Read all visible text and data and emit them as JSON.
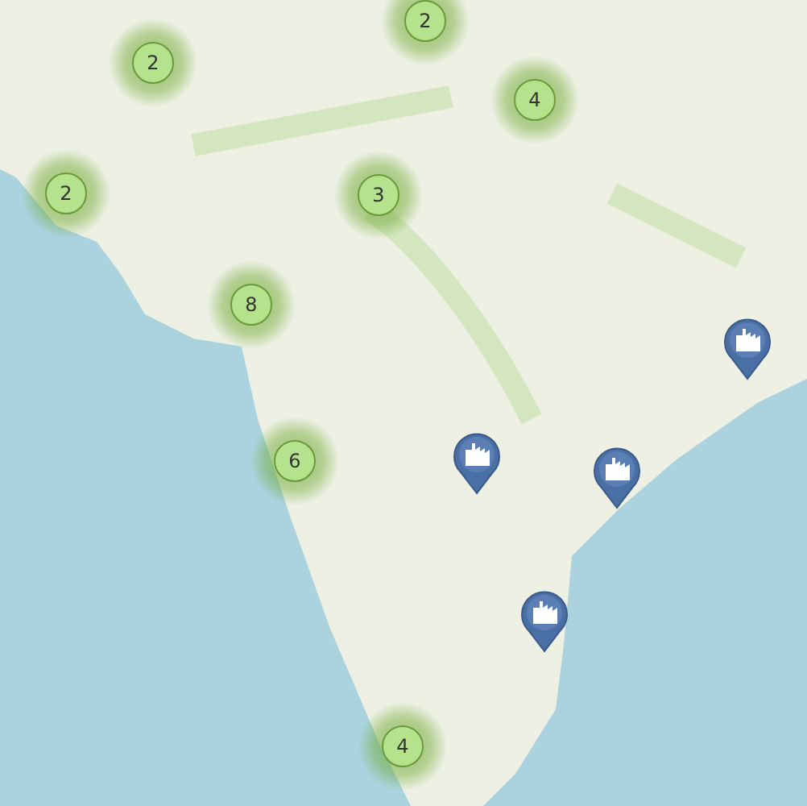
{
  "map": {
    "clusters": [
      {
        "count": "2"
      },
      {
        "count": "2"
      },
      {
        "count": "4"
      },
      {
        "count": "2"
      },
      {
        "count": "3"
      },
      {
        "count": "8"
      },
      {
        "count": "6"
      },
      {
        "count": "4"
      }
    ],
    "markers": [
      {
        "kind": "factory"
      },
      {
        "kind": "factory"
      },
      {
        "kind": "factory"
      },
      {
        "kind": "factory"
      }
    ]
  }
}
